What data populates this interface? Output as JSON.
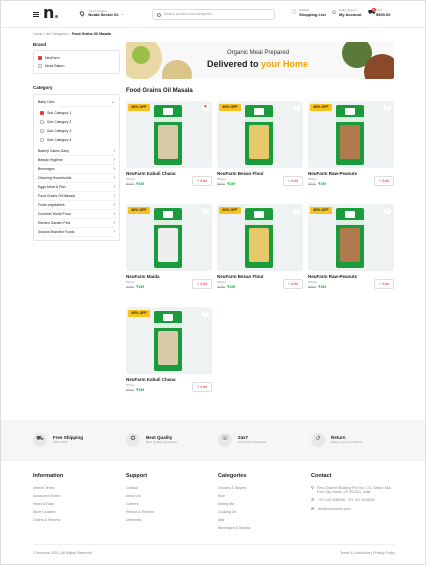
{
  "header": {
    "location_label": "Your Location",
    "location_value": "Noida Sector 62",
    "search_placeholder": "Search product and categories",
    "shopping_list_small": "Wishlist",
    "shopping_list": "Shopping List",
    "account_small": "Hello, Sign In",
    "account": "My Account",
    "cart_small": "Cart",
    "cart_total": "$500.00",
    "cart_count": "0"
  },
  "breadcrumb": {
    "home": "Home",
    "sep": ">",
    "all": "All Categories",
    "current": "Food Grains Oil Masala"
  },
  "sidebar": {
    "brand_title": "Brand",
    "brands": [
      {
        "label": "NeuFarm",
        "checked": true
      },
      {
        "label": "Nova Saturn",
        "checked": false
      }
    ],
    "category_title": "Category",
    "baby_care": "Baby Care",
    "subcategories": [
      {
        "label": "Sub Category 1",
        "checked": true
      },
      {
        "label": "Sub Category 2",
        "checked": false
      },
      {
        "label": "Sub Category 3",
        "checked": false
      },
      {
        "label": "Sub Category 4",
        "checked": false
      }
    ],
    "categories": [
      "Bakery Cakes Dairy",
      "Beauty Hygiene",
      "Beverages",
      "Cleaning Households",
      "Eggs Meat & Fish",
      "Food Grains Oil Masala",
      "Fruits vegetables",
      "Gourmet World Food",
      "Kitchen Garden Pets",
      "Snacks Branded Foods"
    ]
  },
  "banner": {
    "line1": "Organic Meal Prepared",
    "line2_a": "Delivered to ",
    "line2_b": "your Home"
  },
  "section_title": "Food Grains Oil Masala",
  "products": [
    {
      "name": "NeuFarm Kabuli Chana",
      "weight": "500gm",
      "old_price": "₹990",
      "new_price": "₹159",
      "badge": "60% OFF",
      "add": "+ Add",
      "fav": true,
      "fill": "beige"
    },
    {
      "name": "NeuFarm Besan Flour",
      "weight": "500gm",
      "old_price": "₹990",
      "new_price": "₹159",
      "badge": "60% OFF",
      "add": "+ Add",
      "fav": false,
      "fill": "yellow"
    },
    {
      "name": "NeuFarm Raw-Peanuts",
      "weight": "500gm",
      "old_price": "₹990",
      "new_price": "₹159",
      "badge": "60% OFF",
      "add": "+ Add",
      "fav": false,
      "fill": "brown"
    },
    {
      "name": "NeuFarm Maida",
      "weight": "500gm",
      "old_price": "₹990",
      "new_price": "₹159",
      "badge": "60% OFF",
      "add": "+ Add",
      "fav": false,
      "fill": "white"
    },
    {
      "name": "NeuFarm Besan Flour",
      "weight": "500gm",
      "old_price": "₹990",
      "new_price": "₹159",
      "badge": "60% OFF",
      "add": "+ Add",
      "fav": false,
      "fill": "yellow"
    },
    {
      "name": "NeuFarm Raw-Peanuts",
      "weight": "500gm",
      "old_price": "₹990",
      "new_price": "₹159",
      "badge": "60% OFF",
      "add": "+ Add",
      "fav": false,
      "fill": "brown"
    },
    {
      "name": "NeuFarm Kabuli Chana",
      "weight": "500gm",
      "old_price": "₹990",
      "new_price": "₹159",
      "badge": "60% OFF",
      "add": "+ Add",
      "fav": false,
      "fill": "beige"
    }
  ],
  "features": [
    {
      "title": "Free Shipping",
      "sub": "Above $99",
      "icon": "truck-icon"
    },
    {
      "title": "Best Quality",
      "sub": "Best Quality Guarantee",
      "icon": "quality-icon"
    },
    {
      "title": "24x7",
      "sub": "Customer Assistance",
      "icon": "support-icon"
    },
    {
      "title": "Return",
      "sub": "Easy to return products",
      "icon": "return-icon"
    }
  ],
  "footer": {
    "information_title": "Information",
    "information": [
      "Search Terms",
      "Advanced Search",
      "Helps & Faqs",
      "Store Location",
      "Orders & Returns"
    ],
    "support_title": "Support",
    "support": [
      "Contact",
      "About Us",
      "Careers",
      "Refund & Returns",
      "Deliveries"
    ],
    "categories_title": "Categories",
    "categories": [
      "Grocery & Staples",
      "Rice",
      "Mixing Ma",
      "Cooking Oil",
      "Atta",
      "Beverages & Snacks"
    ],
    "contact_title": "Contact",
    "address": "First Channel Building Plot No: 174, Sector 18A, First City, Noida, UP 201301, India",
    "phone": "+91 120 4258336, +91 120 4240000",
    "email": "info@neuromen.com",
    "copyright": "© Neuome 2021 | All Rights Reserved",
    "terms": "Terms & Conditions | Privacy Policy"
  }
}
